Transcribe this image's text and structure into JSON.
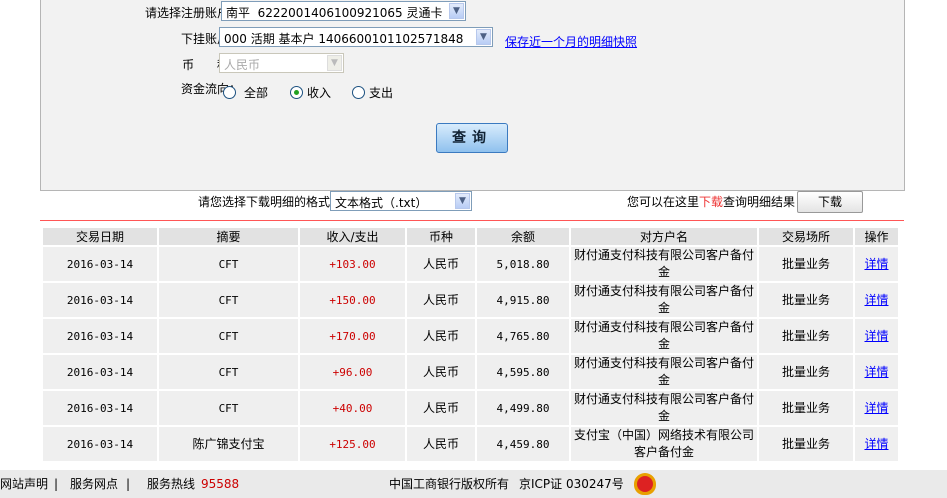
{
  "form": {
    "account_label": "请选择注册账户：",
    "account_value": "南平  6222001406100921065 灵通卡",
    "sub_account_label": "下挂账户：",
    "sub_account_value": "000 活期 基本户 1406600101102571848",
    "snapshot_link": "保存近一个月的明细快照",
    "currency_label": "币      种：",
    "currency_value": "人民币",
    "flow_label": "资金流向：",
    "flow_options": [
      {
        "label": "全部",
        "checked": false
      },
      {
        "label": "收入",
        "checked": true
      },
      {
        "label": "支出",
        "checked": false
      }
    ],
    "query_button": "查询"
  },
  "download": {
    "format_label": "请您选择下载明细的格式",
    "format_value": "文本格式（.txt）",
    "hint_pre": "您可以在这里",
    "hint_red": "下载",
    "hint_post": "查询明细结果",
    "button": "下载"
  },
  "table": {
    "headers": [
      "交易日期",
      "摘要",
      "收入/支出",
      "币种",
      "余额",
      "对方户名",
      "交易场所",
      "操作"
    ],
    "rows": [
      [
        "2016-03-14",
        "CFT",
        "+103.00",
        "人民币",
        "5,018.80",
        "财付通支付科技有限公司客户备付金",
        "批量业务",
        "详情"
      ],
      [
        "2016-03-14",
        "CFT",
        "+150.00",
        "人民币",
        "4,915.80",
        "财付通支付科技有限公司客户备付金",
        "批量业务",
        "详情"
      ],
      [
        "2016-03-14",
        "CFT",
        "+170.00",
        "人民币",
        "4,765.80",
        "财付通支付科技有限公司客户备付金",
        "批量业务",
        "详情"
      ],
      [
        "2016-03-14",
        "CFT",
        "+96.00",
        "人民币",
        "4,595.80",
        "财付通支付科技有限公司客户备付金",
        "批量业务",
        "详情"
      ],
      [
        "2016-03-14",
        "CFT",
        "+40.00",
        "人民币",
        "4,499.80",
        "财付通支付科技有限公司客户备付金",
        "批量业务",
        "详情"
      ],
      [
        "2016-03-14",
        "陈广锦支付宝",
        "+125.00",
        "人民币",
        "4,459.80",
        "支付宝（中国）网络技术有限公司客户备付金",
        "批量业务",
        "详情"
      ]
    ]
  },
  "footer": {
    "links": [
      "网站声明",
      "服务网点"
    ],
    "hotline_label": "服务热线",
    "hotline": "95588",
    "copyright": "中国工商银行版权所有",
    "icp": "京ICP证 030247号"
  }
}
